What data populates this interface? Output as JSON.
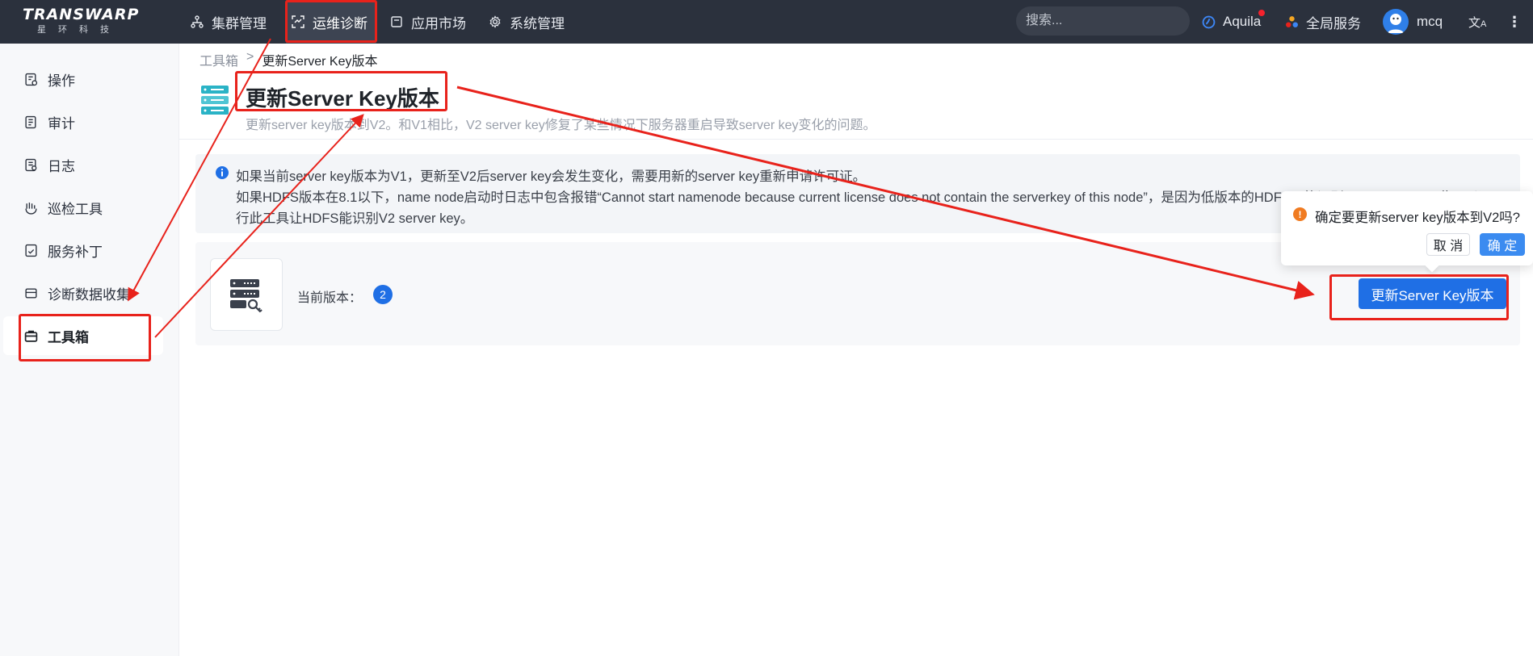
{
  "topbar": {
    "logo_main": "TRANSWARP",
    "logo_sub": "星环科技",
    "nav": [
      {
        "label": "集群管理",
        "icon": "cluster-icon"
      },
      {
        "label": "运维诊断",
        "icon": "diagnose-icon",
        "active": true
      },
      {
        "label": "应用市场",
        "icon": "market-icon"
      },
      {
        "label": "系统管理",
        "icon": "gear-icon"
      }
    ],
    "search_placeholder": "搜索...",
    "aquila_label": "Aquila",
    "global_services_label": "全局服务",
    "user_name": "mcq"
  },
  "sidebar": {
    "items": [
      {
        "label": "操作",
        "icon": "operation-icon"
      },
      {
        "label": "审计",
        "icon": "audit-icon"
      },
      {
        "label": "日志",
        "icon": "log-icon"
      },
      {
        "label": "巡检工具",
        "icon": "inspect-icon"
      },
      {
        "label": "服务补丁",
        "icon": "patch-icon"
      },
      {
        "label": "诊断数据收集",
        "icon": "collect-icon"
      },
      {
        "label": "工具箱",
        "icon": "toolbox-icon",
        "active": true
      }
    ]
  },
  "breadcrumb": {
    "root": "工具箱",
    "separator": ">",
    "current": "更新Server Key版本"
  },
  "page": {
    "title": "更新Server Key版本",
    "description": "更新server key版本到V2。和V1相比，V2 server key修复了某些情况下服务器重启导致server key变化的问题。"
  },
  "alert": {
    "line1": "如果当前server key版本为V1，更新至V2后server key会发生变化，需要用新的server key重新申请许可证。",
    "line2": "如果HDFS版本在8.1以下，name node启动时日志中包含报错“Cannot start namenode because current license does not contain the serverkey of this node”，是因为低版本的HDFS只能识别V1 server key，此可以运",
    "line3": "行此工具让HDFS能识别V2 server key。"
  },
  "card": {
    "version_label": "当前版本：",
    "version_value": "2",
    "update_button": "更新Server Key版本"
  },
  "popconfirm": {
    "message": "确定要更新server key版本到V2吗?",
    "cancel": "取 消",
    "ok": "确 定"
  },
  "colors": {
    "topbar_bg": "#2b313d",
    "primary": "#1f6fe5",
    "annotation_red": "#e8221b",
    "warning": "#f07b21"
  }
}
